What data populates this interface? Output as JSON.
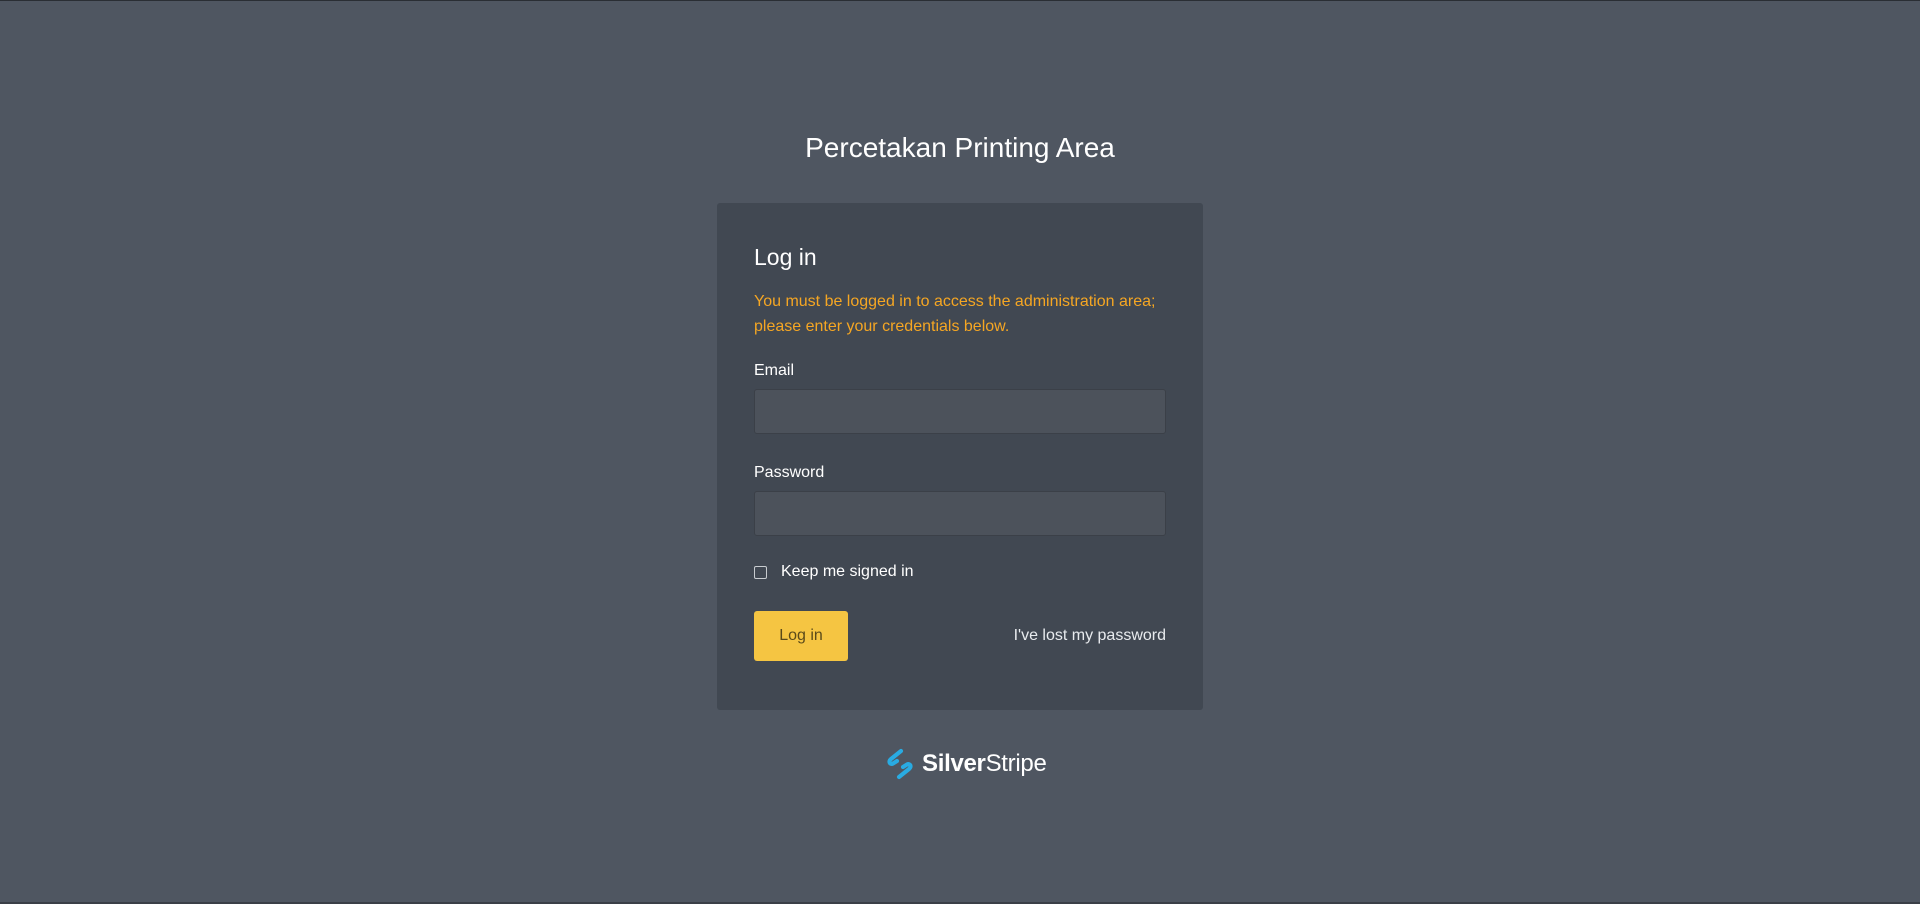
{
  "page": {
    "site_title": "Percetakan Printing Area"
  },
  "login_form": {
    "heading": "Log in",
    "message": "You must be logged in to access the administration area; please enter your credentials below.",
    "email_label": "Email",
    "email_value": "",
    "password_label": "Password",
    "password_value": "",
    "remember_label": "Keep me signed in",
    "remember_checked": false,
    "submit_label": "Log in",
    "lost_password_label": "I've lost my password"
  },
  "brand": {
    "name_part1": "Silver",
    "name_part2": "Stripe",
    "icon": "silverstripe-logo-icon"
  },
  "colors": {
    "background": "#4f5661",
    "card": "#414852",
    "input": "#4c525b",
    "warning_text": "#f5a623",
    "accent_button": "#f5c542",
    "brand_icon": "#29abe2"
  }
}
